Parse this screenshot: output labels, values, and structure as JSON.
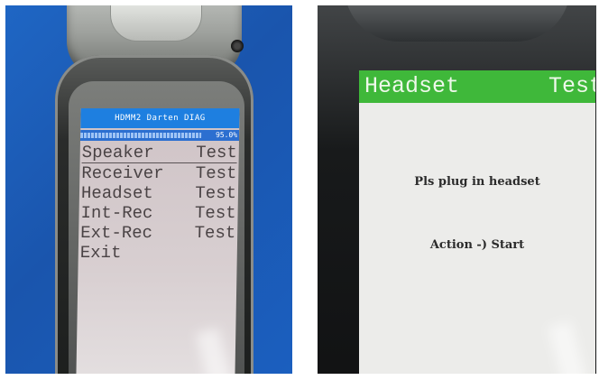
{
  "left_screen": {
    "title": "HDMM2 Darten DIAG",
    "progress_text": "95.0%",
    "progress": 0.95,
    "menu": [
      {
        "name": "Speaker",
        "action": "Test",
        "selected": true
      },
      {
        "name": "Receiver",
        "action": "Test"
      },
      {
        "name": "Headset",
        "action": "Test"
      },
      {
        "name": "Int-Rec",
        "action": "Test"
      },
      {
        "name": "Ext-Rec",
        "action": "Test"
      },
      {
        "name": "Exit",
        "action": ""
      }
    ]
  },
  "right_screen": {
    "header_word1": "Headset",
    "header_word2": "Test",
    "message": "Pls plug in headset",
    "action_text": "Action -) Start"
  },
  "colors": {
    "left_title_bar": "#1e7fe0",
    "right_header_bar": "#3fb83a",
    "backdrop_blue": "#1a55ad"
  }
}
